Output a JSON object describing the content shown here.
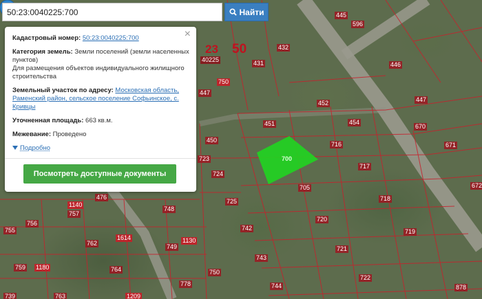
{
  "search": {
    "value": "50:23:0040225:700",
    "button_label": "Найти"
  },
  "popup": {
    "close_symbol": "×",
    "cadastral_label": "Кадастровый номер:",
    "cadastral_value": "50:23:0040225:700",
    "category_label": "Категория земель:",
    "category_value": "Земли поселений (земли населенных пунктов)",
    "usage_value": "Для размещения объектов индивидуального жилищного строительства",
    "address_label": "Земельный участок по адресу:",
    "address_value": "Московская область, Раменский район, сельское поселение Софьинское, с. Кривцы",
    "area_label": "Уточненная площадь:",
    "area_value": "663 кв.м.",
    "survey_label": "Межевание:",
    "survey_value": "Проведено",
    "details_label": "Подробно",
    "docs_button_label": "Посмотреть доступные документы"
  },
  "map": {
    "quarter_labels": [
      "23",
      "50"
    ],
    "block_number": "40225",
    "selected_plot_label": "700",
    "plot_labels": [
      "445",
      "596",
      "432",
      "431",
      "446",
      "452",
      "447",
      "451",
      "454",
      "670",
      "450",
      "716",
      "671",
      "723",
      "724",
      "705",
      "717",
      "672",
      "725",
      "718",
      "748",
      "742",
      "720",
      "719",
      "762",
      "749",
      "721",
      "743",
      "764",
      "750",
      "722",
      "744",
      "878",
      "755",
      "757",
      "756",
      "759",
      "763",
      "1140",
      "1130",
      "1614",
      "1180",
      "1209",
      "778",
      "476",
      "447",
      "739",
      "750"
    ],
    "selected_color": "#22d322",
    "line_color": "#c8202c"
  }
}
